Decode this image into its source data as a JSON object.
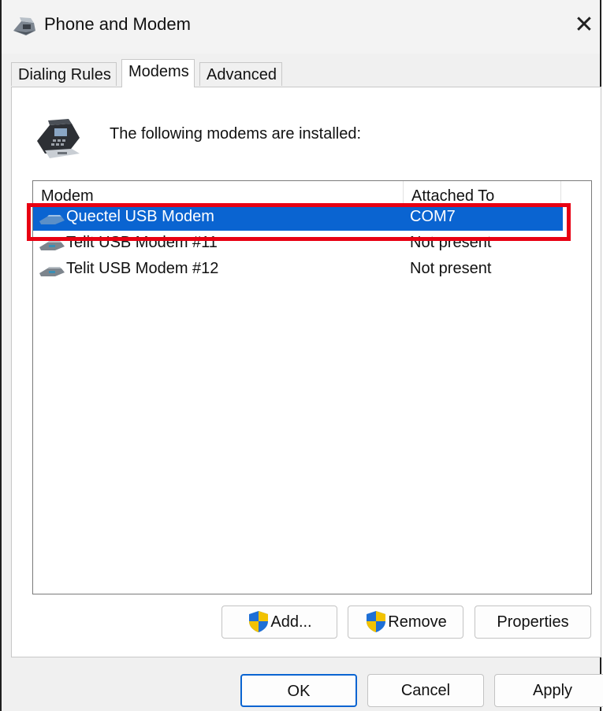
{
  "window": {
    "title": "Phone and Modem",
    "title_icon": "phone-modem-icon",
    "close_icon": "close-icon",
    "close_glyph": "✕"
  },
  "tabs": [
    {
      "label": "Dialing Rules",
      "active": false
    },
    {
      "label": "Modems",
      "active": true
    },
    {
      "label": "Advanced",
      "active": false
    }
  ],
  "modems_panel": {
    "intro_text": "The following modems are installed:",
    "intro_icon": "telephone-icon",
    "columns": [
      "Modem",
      "Attached To"
    ],
    "rows": [
      {
        "modem": "Quectel USB Modem",
        "attached_to": "COM7",
        "selected": true
      },
      {
        "modem": "Telit USB Modem #11",
        "attached_to": "Not present",
        "selected": false
      },
      {
        "modem": "Telit USB Modem #12",
        "attached_to": "Not present",
        "selected": false
      }
    ],
    "buttons": {
      "add": "Add...",
      "remove": "Remove",
      "properties": "Properties"
    }
  },
  "dialog_buttons": {
    "ok": "OK",
    "cancel": "Cancel",
    "apply": "Apply"
  },
  "colors": {
    "selection": "#0a64d1",
    "highlight_box": "#e80012",
    "window_bg": "#f0f0f0"
  }
}
